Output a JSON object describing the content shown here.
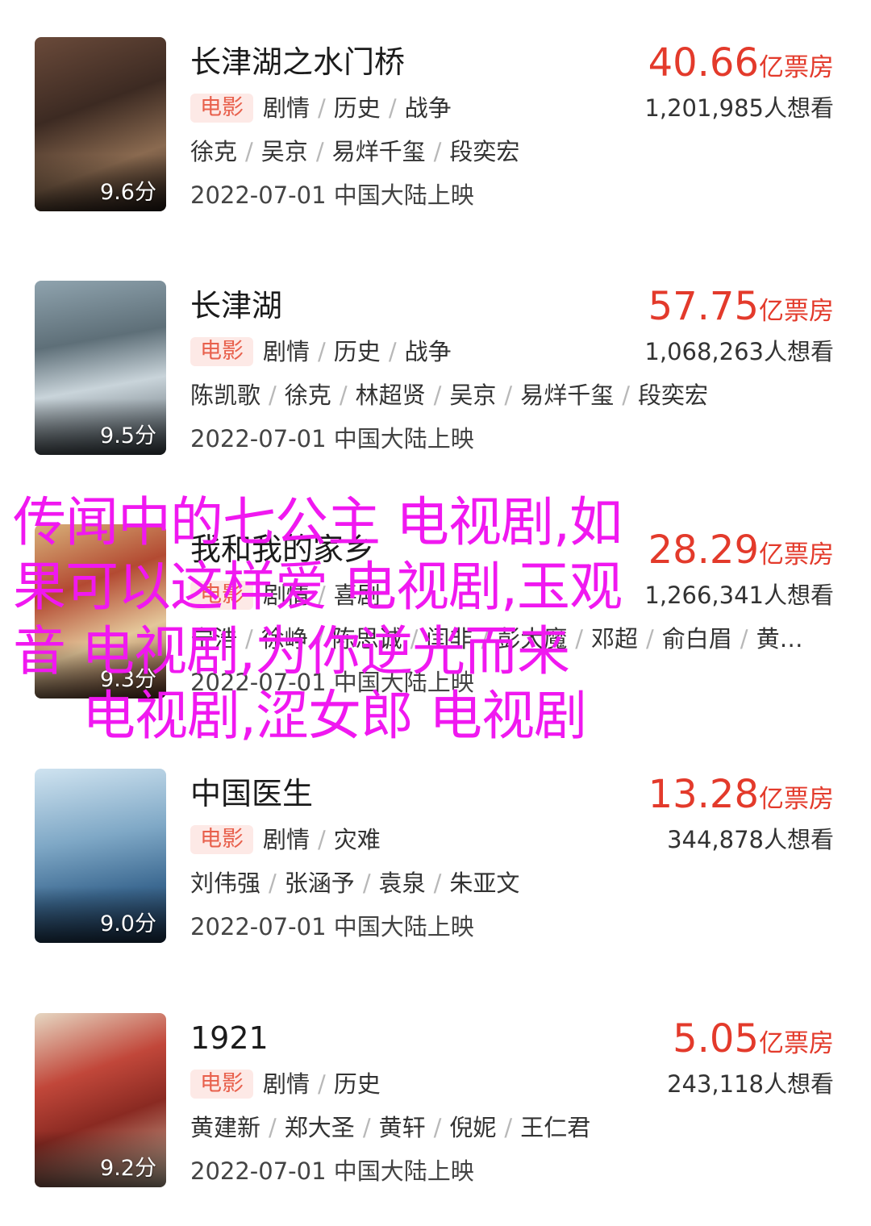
{
  "movies": [
    {
      "title": "长津湖之水门桥",
      "box_office": "40.66",
      "box_unit": "亿票房",
      "type_tag": "电影",
      "genres": [
        "剧情",
        "历史",
        "战争"
      ],
      "want": "1,201,985人想看",
      "cast": [
        "徐克",
        "吴京",
        "易烊千玺",
        "段奕宏"
      ],
      "release": "2022-07-01 中国大陆上映",
      "score": "9.6分"
    },
    {
      "title": "长津湖",
      "box_office": "57.75",
      "box_unit": "亿票房",
      "type_tag": "电影",
      "genres": [
        "剧情",
        "历史",
        "战争"
      ],
      "want": "1,068,263人想看",
      "cast": [
        "陈凯歌",
        "徐克",
        "林超贤",
        "吴京",
        "易烊千玺",
        "段奕宏"
      ],
      "release": "2022-07-01 中国大陆上映",
      "score": "9.5分"
    },
    {
      "title": "我和我的家乡",
      "box_office": "28.29",
      "box_unit": "亿票房",
      "type_tag": "电影",
      "genres": [
        "剧情",
        "喜剧"
      ],
      "want": "1,266,341人想看",
      "cast": [
        "宁浩",
        "徐峥",
        "陈思诚",
        "闫非",
        "彭大魔",
        "邓超",
        "俞白眉",
        "黄…"
      ],
      "release": "2022-07-01 中国大陆上映",
      "score": "9.3分"
    },
    {
      "title": "中国医生",
      "box_office": "13.28",
      "box_unit": "亿票房",
      "type_tag": "电影",
      "genres": [
        "剧情",
        "灾难"
      ],
      "want": "344,878人想看",
      "cast": [
        "刘伟强",
        "张涵予",
        "袁泉",
        "朱亚文"
      ],
      "release": "2022-07-01 中国大陆上映",
      "score": "9.0分"
    },
    {
      "title": "1921",
      "box_office": "5.05",
      "box_unit": "亿票房",
      "type_tag": "电影",
      "genres": [
        "剧情",
        "历史"
      ],
      "want": "243,118人想看",
      "cast": [
        "黄建新",
        "郑大圣",
        "黄轩",
        "倪妮",
        "王仁君"
      ],
      "release": "2022-07-01 中国大陆上映",
      "score": "9.2分"
    }
  ],
  "overlay": {
    "line1": "传闻中的七公主 电视剧,如",
    "line2": "果可以这样爱 电视剧,玉观",
    "line3": "音 电视剧,为你逆光而来",
    "line4": "电视剧,涩女郎 电视剧"
  },
  "colors": {
    "accent": "#e33a2b",
    "tag_text": "#e8604c",
    "tag_bg": "#fde9e6",
    "overlay": "#f018f0"
  }
}
